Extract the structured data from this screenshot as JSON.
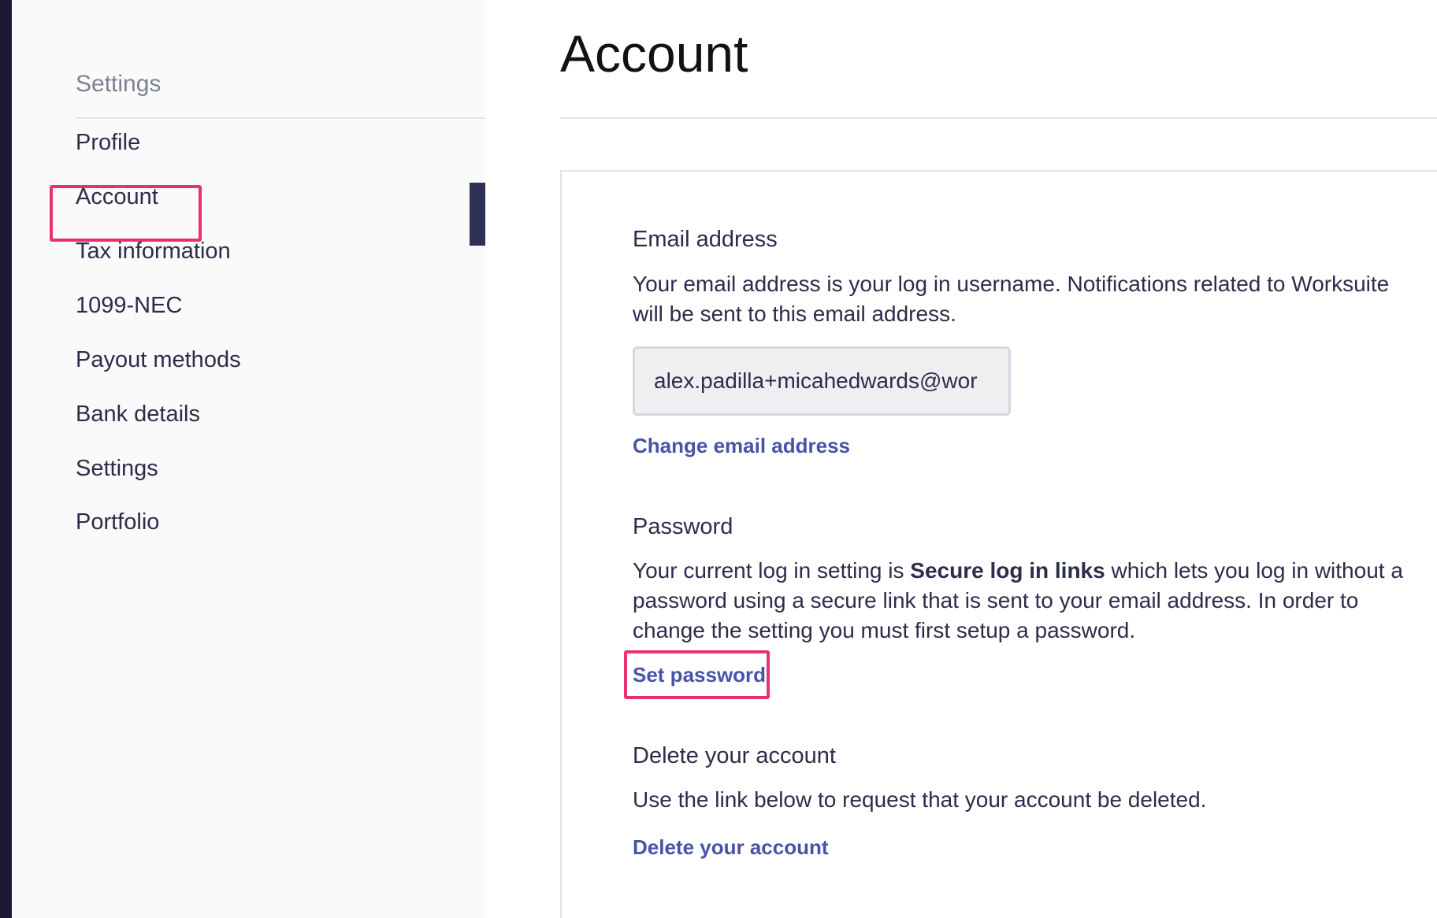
{
  "sidebar": {
    "heading": "Settings",
    "items": [
      {
        "label": "Profile"
      },
      {
        "label": "Account"
      },
      {
        "label": "Tax information"
      },
      {
        "label": "1099-NEC"
      },
      {
        "label": "Payout methods"
      },
      {
        "label": "Bank details"
      },
      {
        "label": "Settings"
      },
      {
        "label": "Portfolio"
      }
    ],
    "active_item": "Account"
  },
  "main": {
    "title": "Account",
    "email_section": {
      "title": "Email address",
      "description": "Your email address is your log in username. Notifications related to Worksuite will be sent to this email address.",
      "input_value": "alex.padilla+micahedwards@wor",
      "change_link": "Change email address"
    },
    "password_section": {
      "title": "Password",
      "description_prefix": "Your current log in setting is ",
      "description_bold": "Secure log in links",
      "description_suffix": " which lets you log in without a password using a secure link that is sent to your email address. In order to change the setting you must first setup a password.",
      "set_password_link": "Set password"
    },
    "delete_section": {
      "title": "Delete your account",
      "description": "Use the link below to request that your account be deleted.",
      "delete_link": "Delete your account"
    }
  },
  "colors": {
    "highlight": "#e8316f",
    "link": "#4654a8",
    "active_indicator": "#2d3154"
  }
}
